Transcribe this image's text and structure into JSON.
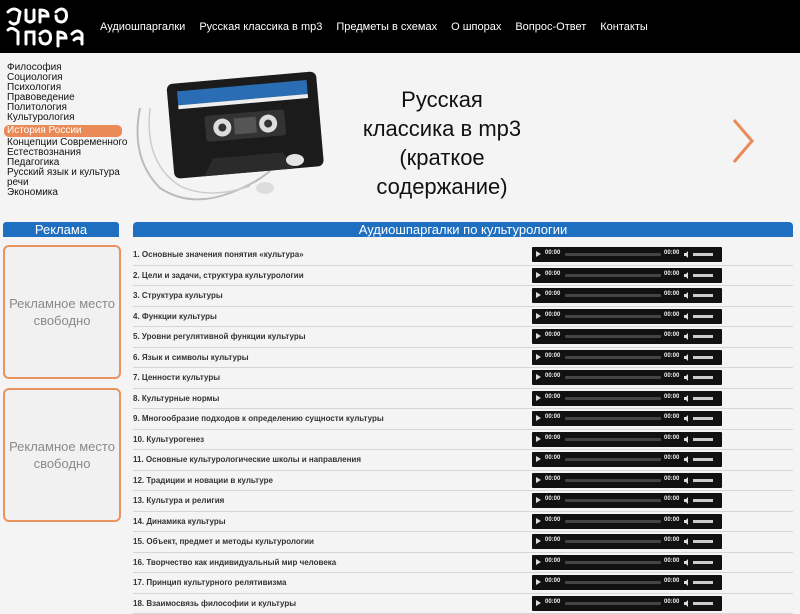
{
  "header": {
    "nav": [
      "Аудиошпаргалки",
      "Русская классика в mp3",
      "Предметы в схемах",
      "О шпорах",
      "Вопрос-Ответ",
      "Контакты"
    ]
  },
  "sidebar": {
    "categories": [
      "Философия",
      "Социология",
      "Психология",
      "Правоведение",
      "Политология",
      "Культурология",
      "История России",
      "Концепции Современного",
      "Естествознания",
      "Педагогика",
      "Русский язык и культура",
      "речи",
      "Экономика"
    ],
    "active_index": 6
  },
  "banner": {
    "lines": [
      "Русская",
      "классика в mp3",
      "(краткое",
      "содержание)"
    ]
  },
  "ads": {
    "title": "Реклама",
    "box_text": "Рекламное место свободно"
  },
  "main": {
    "title": "Аудиошпаргалки по культурологии",
    "player_time": "00:00",
    "items": [
      "1. Основные значения понятия «культура»",
      "2. Цели и задачи, структура культурологии",
      "3. Структура культуры",
      "4. Функции культуры",
      "5. Уровни регулятивной функции культуры",
      "6. Язык и символы культуры",
      "7. Ценности культуры",
      "8. Культурные нормы",
      "9. Многообразие подходов к определению сущности культуры",
      "10. Культурогенез",
      "11. Основные культурологические школы и направления",
      "12. Традиции и новации в культуре",
      "13. Культура и религия",
      "14. Динамика культуры",
      "15. Объект, предмет и методы культурологии",
      "16. Творчество как индивидуальный мир человека",
      "17. Принцип культурного релятивизма",
      "18. Взаимосвязь философии и культуры"
    ]
  },
  "colors": {
    "accent_blue": "#1e6fc0",
    "accent_orange": "#e98a57"
  }
}
